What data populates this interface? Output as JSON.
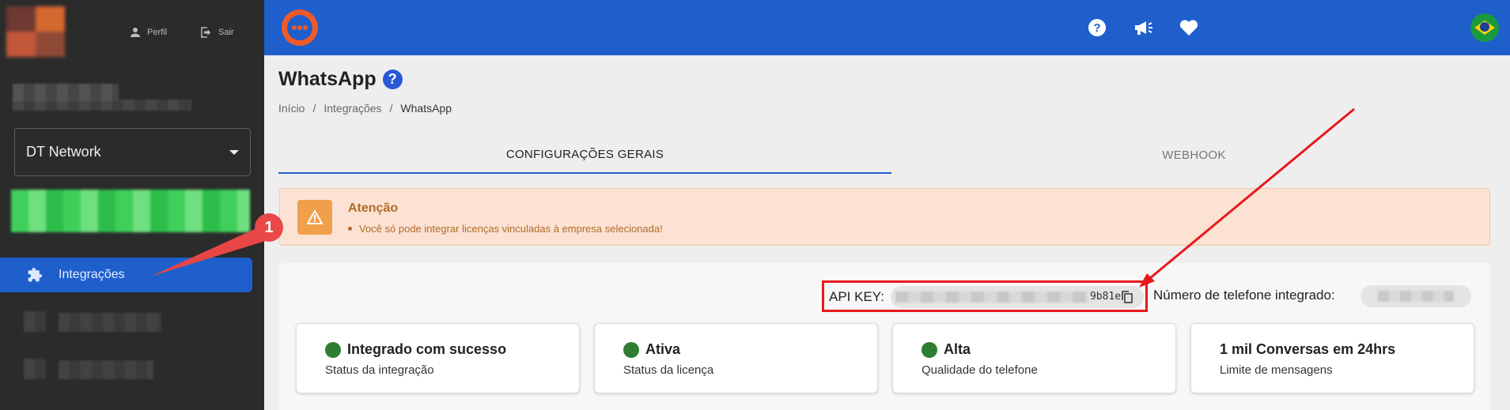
{
  "sidebar": {
    "profile_label": "Perfil",
    "logout_label": "Sair",
    "company_selected": "DT Network",
    "nav_active_label": "Integrações"
  },
  "header": {
    "icons": [
      "help-icon",
      "megaphone-icon",
      "heart-icon",
      "brazil-flag-icon"
    ]
  },
  "page": {
    "title": "WhatsApp",
    "help_glyph": "?",
    "breadcrumb": [
      "Início",
      "Integrações",
      "WhatsApp"
    ],
    "breadcrumb_sep": "/"
  },
  "tabs": [
    {
      "label": "CONFIGURAÇÕES GERAIS",
      "active": true
    },
    {
      "label": "WEBHOOK",
      "active": false
    }
  ],
  "alert": {
    "title": "Atenção",
    "message": "Você só pode integrar licenças vinculadas à empresa selecionada!"
  },
  "integration": {
    "api_key_label": "API KEY:",
    "api_key_visible_suffix": "9b81e",
    "phone_label": "Número de telefone integrado:"
  },
  "status_cards": [
    {
      "title": "Integrado com sucesso",
      "subtitle": "Status da integração",
      "dot": true,
      "dot_color": "#2e7d32"
    },
    {
      "title": "Ativa",
      "subtitle": "Status da licença",
      "dot": true,
      "dot_color": "#2e7d32"
    },
    {
      "title": "Alta",
      "subtitle": "Qualidade do telefone",
      "dot": true,
      "dot_color": "#2e7d32"
    },
    {
      "title": "1 mil Conversas em 24hrs",
      "subtitle": "Limite de mensagens",
      "dot": false
    }
  ],
  "annotations": {
    "step_number": "1"
  },
  "colors": {
    "brand_blue": "#1e5fcc",
    "sidebar_bg": "#2b2b2b",
    "alert_bg": "#fbe2d3",
    "annotation_red": "#e8191c"
  }
}
